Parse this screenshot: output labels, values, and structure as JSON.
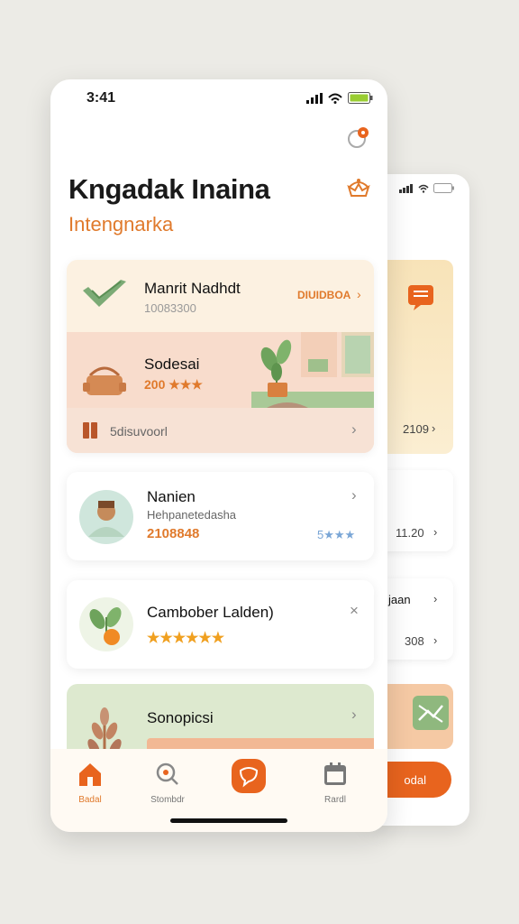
{
  "status": {
    "time": "3:41"
  },
  "header": {
    "title": "Kngadak Inaina",
    "subtitle": "Intengnarka"
  },
  "featured": {
    "item1": {
      "name": "Manrit Nadhdt",
      "code": "10083300",
      "action": "DIUIDBOA"
    },
    "item2": {
      "name": "Sodesai",
      "rating": "200 ★★★"
    },
    "footer_label": "5disuvoorl"
  },
  "list": [
    {
      "name": "Nanien",
      "subtitle": "Hehpanetedasha",
      "value": "2108848",
      "rating": "5★★★"
    },
    {
      "name": "Cambober Lalden)",
      "rating": "★★★★★★"
    },
    {
      "name": "Sonopicsi"
    }
  ],
  "back_screen": {
    "card1_value": "2109",
    "card2_value": "11.20",
    "card3_label": "jaan",
    "card3_value": "308",
    "button_label": "odal"
  },
  "tabs": [
    {
      "label": "Badal",
      "icon": "home-icon"
    },
    {
      "label": "Stombdr",
      "icon": "search-icon"
    },
    {
      "label": "",
      "icon": "chat-icon"
    },
    {
      "label": "Rardl",
      "icon": "calendar-icon"
    }
  ],
  "colors": {
    "accent": "#e8641e",
    "accent_text": "#e07a2c",
    "card_peach": "#f8dccc",
    "card_green": "#dde9cf"
  }
}
